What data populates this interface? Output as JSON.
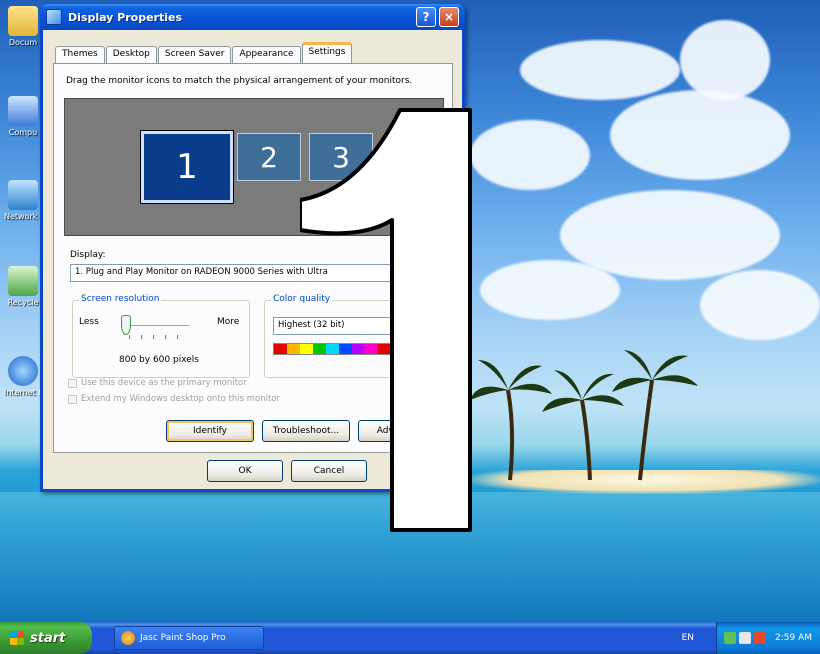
{
  "window": {
    "title": "Display Properties",
    "help_btn": "?",
    "close_btn": "×"
  },
  "tabs": [
    {
      "label": "Themes",
      "active": false
    },
    {
      "label": "Desktop",
      "active": false
    },
    {
      "label": "Screen Saver",
      "active": false
    },
    {
      "label": "Appearance",
      "active": false
    },
    {
      "label": "Settings",
      "active": true
    }
  ],
  "settings": {
    "instruction": "Drag the monitor icons to match the physical arrangement of your monitors.",
    "monitors": [
      "1",
      "2",
      "3"
    ],
    "display_label": "Display:",
    "display_value": "1. Plug and Play Monitor on RADEON 9000 Series with Ultra",
    "resolution": {
      "legend": "Screen resolution",
      "less": "Less",
      "more": "More",
      "value": "800 by 600 pixels"
    },
    "color_quality": {
      "legend": "Color quality",
      "value": "Highest (32 bit)"
    },
    "checkbox_primary": "Use this device as the primary monitor",
    "checkbox_extend": "Extend my Windows desktop onto this monitor",
    "buttons": {
      "identify": "Identify",
      "troubleshoot": "Troubleshoot...",
      "advanced": "Advanced"
    }
  },
  "footer": {
    "ok": "OK",
    "cancel": "Cancel"
  },
  "overlay_number": "1",
  "taskbar": {
    "start": "start",
    "task_item": "Jasc Paint Shop Pro",
    "language": "EN",
    "clock": "2:59 AM"
  },
  "desktop_icons": [
    "Docum",
    "Compu",
    "Network Places",
    "Recycle",
    "Internet Explorer"
  ],
  "colors": {
    "titlebar": "#0a55d6",
    "dialog": "#ece9d8",
    "accent_tab": "#f7b64a",
    "taskbar": "#2157d7",
    "start_button": "#3a9a35"
  }
}
